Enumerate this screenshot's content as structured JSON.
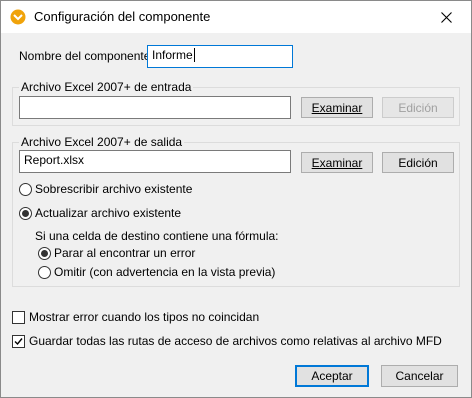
{
  "window": {
    "title": "Configuración del componente",
    "accent": "#f0a30a"
  },
  "component": {
    "label": "Nombre del componente:",
    "value": "Informe"
  },
  "input_section": {
    "legend": "Archivo Excel 2007+ de entrada",
    "file_value": "",
    "browse_label": "Examinar",
    "edit_label": "Edición"
  },
  "output_section": {
    "legend": "Archivo Excel 2007+ de salida",
    "file_value": "Report.xlsx",
    "browse_label": "Examinar",
    "edit_label": "Edición",
    "overwrite_label": "Sobrescribir archivo existente",
    "update_label": "Actualizar archivo existente",
    "formula_text": "Si una celda de destino contiene una fórmula:",
    "stop_label": "Parar al encontrar un error",
    "skip_label": "Omitir (con advertencia en la vista previa)"
  },
  "options": {
    "show_error_label": "Mostrar error cuando los tipos no coincidan",
    "save_relative_label": "Guardar todas las rutas de acceso de archivos como relativas al archivo MFD"
  },
  "footer": {
    "ok_label": "Aceptar",
    "cancel_label": "Cancelar"
  }
}
